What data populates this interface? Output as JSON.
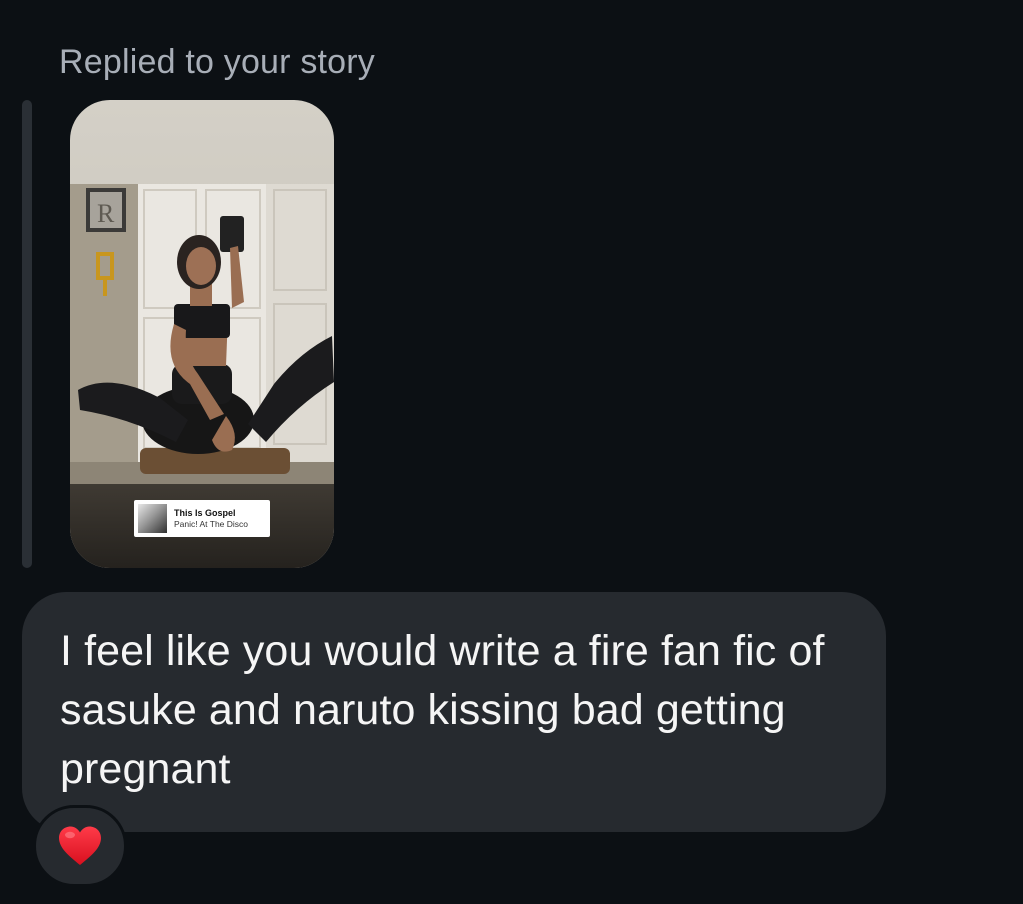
{
  "header": {
    "reply_label": "Replied to your story"
  },
  "story": {
    "music_sticker": {
      "song_title": "This Is Gospel",
      "artist": "Panic! At The Disco"
    }
  },
  "message": {
    "text": "I feel like you would write a fire fan fic of sasuke and naruto kissing bad getting pregnant"
  },
  "reaction": {
    "icon": "heart-icon",
    "color": "#e8192c"
  },
  "colors": {
    "background": "#0c1014",
    "bubble": "#262a2f",
    "secondary_text": "#a8aeb7"
  }
}
